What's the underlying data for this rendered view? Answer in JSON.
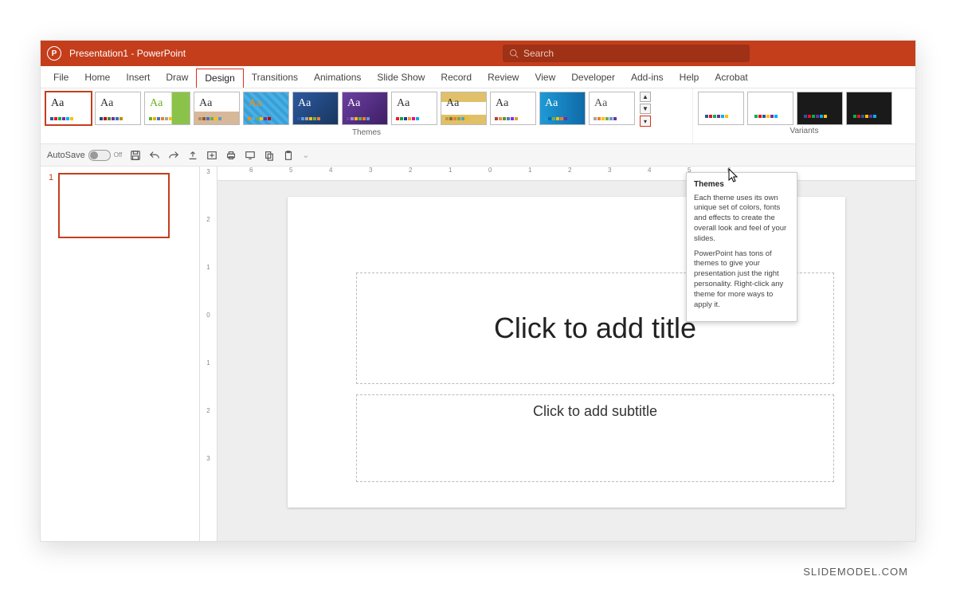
{
  "titlebar": {
    "title": "Presentation1 - PowerPoint",
    "search_placeholder": "Search"
  },
  "tabs": [
    "File",
    "Home",
    "Insert",
    "Draw",
    "Design",
    "Transitions",
    "Animations",
    "Slide Show",
    "Record",
    "Review",
    "View",
    "Developer",
    "Add-ins",
    "Help",
    "Acrobat"
  ],
  "active_tab": "Design",
  "ribbon": {
    "themes_label": "Themes",
    "variants_label": "Variants",
    "themes": [
      {
        "aa": "Aa",
        "aa_color": "#222",
        "bg": "#ffffff",
        "selected": true,
        "colors": [
          "#2b579a",
          "#e81123",
          "#00b050",
          "#7030a0",
          "#00b0f0",
          "#ffc000"
        ]
      },
      {
        "aa": "Aa",
        "aa_color": "#333",
        "bg": "#ffffff",
        "colors": [
          "#1f4e79",
          "#c00000",
          "#548235",
          "#7030a0",
          "#2e75b6",
          "#bf9000"
        ]
      },
      {
        "aa": "Aa",
        "aa_color": "#6ab01e",
        "bg": "linear-gradient(90deg,#fff 60%,#8bc34a 60%)",
        "colors": [
          "#6ab01e",
          "#e2b100",
          "#4472c4",
          "#ed7d31",
          "#a5a5a5",
          "#ffc000"
        ]
      },
      {
        "aa": "Aa",
        "aa_color": "#333",
        "bg": "linear-gradient(#fff 60%,#d7b899 60%)",
        "colors": [
          "#b48a5a",
          "#8f5a2a",
          "#4472c4",
          "#70ad47",
          "#ffc000",
          "#5b9bd5"
        ]
      },
      {
        "aa": "Aa",
        "aa_color": "#ff8a00",
        "bg": "repeating-linear-gradient(45deg,#49b0e6 0 4px,#3a9fd6 4px 8px)",
        "colors": [
          "#ff8a00",
          "#49b0e6",
          "#70ad47",
          "#ffc000",
          "#7030a0",
          "#c00000"
        ]
      },
      {
        "aa": "Aa",
        "aa_color": "#fff",
        "bg": "linear-gradient(135deg,#2d5aa0,#18365f)",
        "colors": [
          "#2d5aa0",
          "#5b9bd5",
          "#a5a5a5",
          "#ffc000",
          "#70ad47",
          "#ed7d31"
        ]
      },
      {
        "aa": "Aa",
        "aa_color": "#fff",
        "bg": "linear-gradient(135deg,#6b3fa0,#3e1f66)",
        "colors": [
          "#6b3fa0",
          "#b085d8",
          "#ffc000",
          "#70ad47",
          "#ed7d31",
          "#5b9bd5"
        ]
      },
      {
        "aa": "Aa",
        "aa_color": "#333",
        "bg": "#ffffff",
        "colors": [
          "#ed1c24",
          "#00a651",
          "#2e3192",
          "#f7941e",
          "#ec008c",
          "#00aeef"
        ]
      },
      {
        "aa": "Aa",
        "aa_color": "#333",
        "bg": "linear-gradient(#e0c068 0 30%,#fff 30% 70%,#e0c068 70%)",
        "colors": [
          "#c19a3f",
          "#8b6f2e",
          "#ed7d31",
          "#70ad47",
          "#5b9bd5",
          "#ffc000"
        ]
      },
      {
        "aa": "Aa",
        "aa_color": "#333",
        "bg": "#ffffff",
        "colors": [
          "#b0413e",
          "#e28f41",
          "#6b8e23",
          "#4682b4",
          "#8a2be2",
          "#daa520"
        ]
      },
      {
        "aa": "Aa",
        "aa_color": "#fff",
        "bg": "linear-gradient(90deg,#1e9ad6,#0f6aa8)",
        "colors": [
          "#1e9ad6",
          "#0f6aa8",
          "#70ad47",
          "#ffc000",
          "#ed7d31",
          "#7030a0"
        ]
      },
      {
        "aa": "Aa",
        "aa_color": "#555",
        "bg": "#ffffff",
        "colors": [
          "#a5a5a5",
          "#ed7d31",
          "#ffc000",
          "#70ad47",
          "#5b9bd5",
          "#7030a0"
        ]
      }
    ],
    "variants": [
      {
        "bg": "#ffffff",
        "colors": [
          "#2b579a",
          "#e81123",
          "#00b050",
          "#7030a0",
          "#00b0f0",
          "#ffc000"
        ]
      },
      {
        "bg": "#ffffff",
        "colors": [
          "#00b050",
          "#e81123",
          "#2b579a",
          "#ffc000",
          "#7030a0",
          "#00b0f0"
        ]
      },
      {
        "bg": "#1a1a1a",
        "colors": [
          "#2b579a",
          "#e81123",
          "#00b050",
          "#7030a0",
          "#00b0f0",
          "#ffc000"
        ]
      },
      {
        "bg": "#1a1a1a",
        "colors": [
          "#00b050",
          "#e81123",
          "#2b579a",
          "#ffc000",
          "#7030a0",
          "#00b0f0"
        ]
      }
    ]
  },
  "qat": {
    "autosave_label": "AutoSave",
    "autosave_state": "Off"
  },
  "hruler_ticks": [
    "6",
    "5",
    "4",
    "3",
    "2",
    "1",
    "0",
    "1",
    "2",
    "3",
    "4",
    "5",
    "6"
  ],
  "vruler_ticks": [
    "3",
    "2",
    "1",
    "0",
    "1",
    "2",
    "3"
  ],
  "thumbnails": {
    "slide1_num": "1"
  },
  "slide": {
    "title_placeholder": "Click to add title",
    "subtitle_placeholder": "Click to add subtitle"
  },
  "tooltip": {
    "title": "Themes",
    "body1": "Each theme uses its own unique set of colors, fonts and effects to create the overall look and feel of your slides.",
    "body2": "PowerPoint has tons of themes to give your presentation just the right personality. Right-click any theme for more ways to apply it."
  },
  "watermark": "SLIDEMODEL.COM"
}
